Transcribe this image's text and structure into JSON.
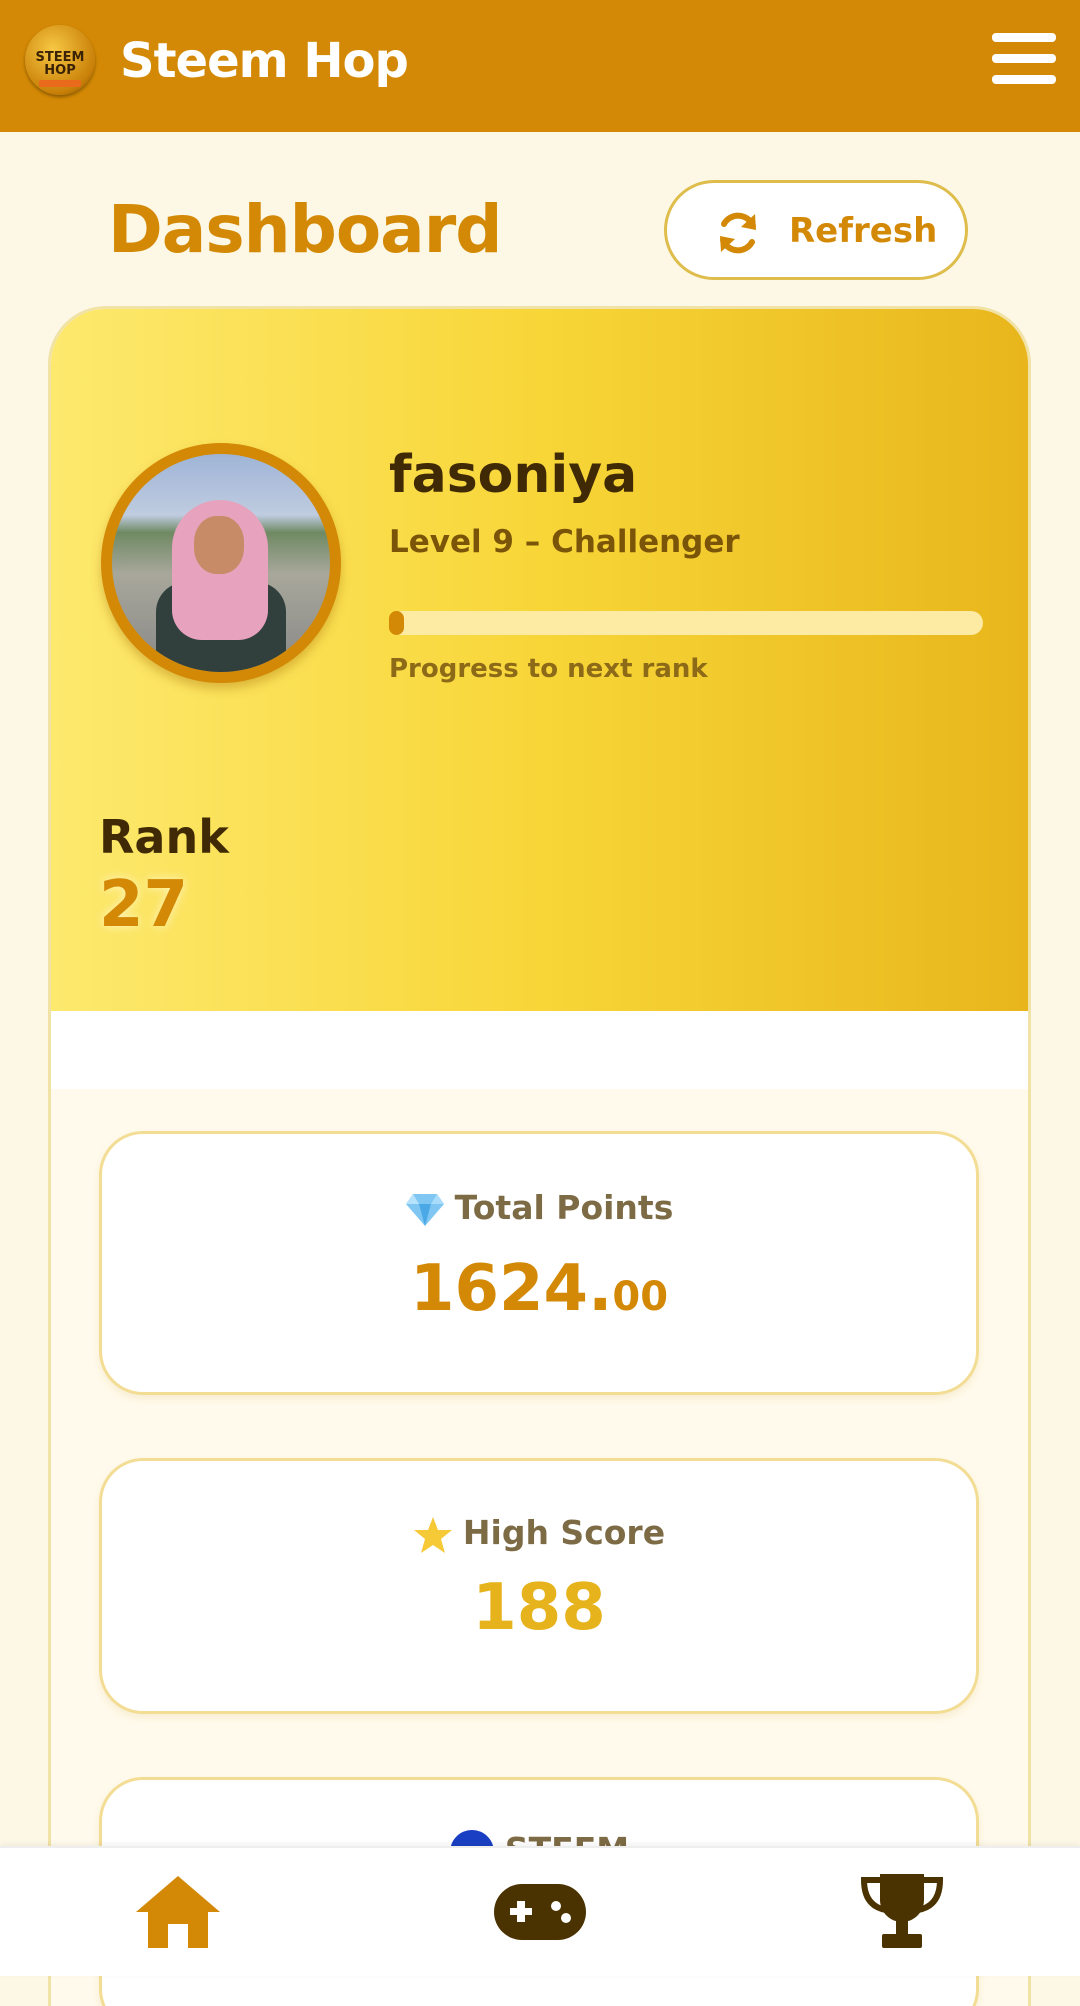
{
  "header": {
    "app_name": "Steem Hop",
    "logo_text_top": "STEEM",
    "logo_text_bottom": "HOP"
  },
  "page": {
    "title": "Dashboard",
    "refresh_label": "Refresh"
  },
  "profile": {
    "username": "fasoniya",
    "level": "Level 9 – Challenger",
    "progress_to_next_rank": 0.02,
    "progress_label": "Progress to next rank",
    "rank_label": "Rank",
    "rank_value": "27"
  },
  "stats": [
    {
      "label": "Total Points",
      "value_whole": "1624.",
      "value_decimals": "00",
      "icon": "gem-icon",
      "color": "#d38905"
    },
    {
      "label": "High Score",
      "value": "188",
      "icon": "star-icon",
      "color": "#e6b31c"
    },
    {
      "label": "STEEM",
      "icon": "steem-icon"
    }
  ],
  "nav": [
    {
      "name": "home",
      "icon": "home-icon",
      "active": true
    },
    {
      "name": "games",
      "icon": "gamepad-icon",
      "active": false
    },
    {
      "name": "leaderboard",
      "icon": "trophy-icon",
      "active": false
    }
  ],
  "colors": {
    "brand": "#d38905",
    "dark": "#3f2a05",
    "accent": "#f8d638"
  }
}
